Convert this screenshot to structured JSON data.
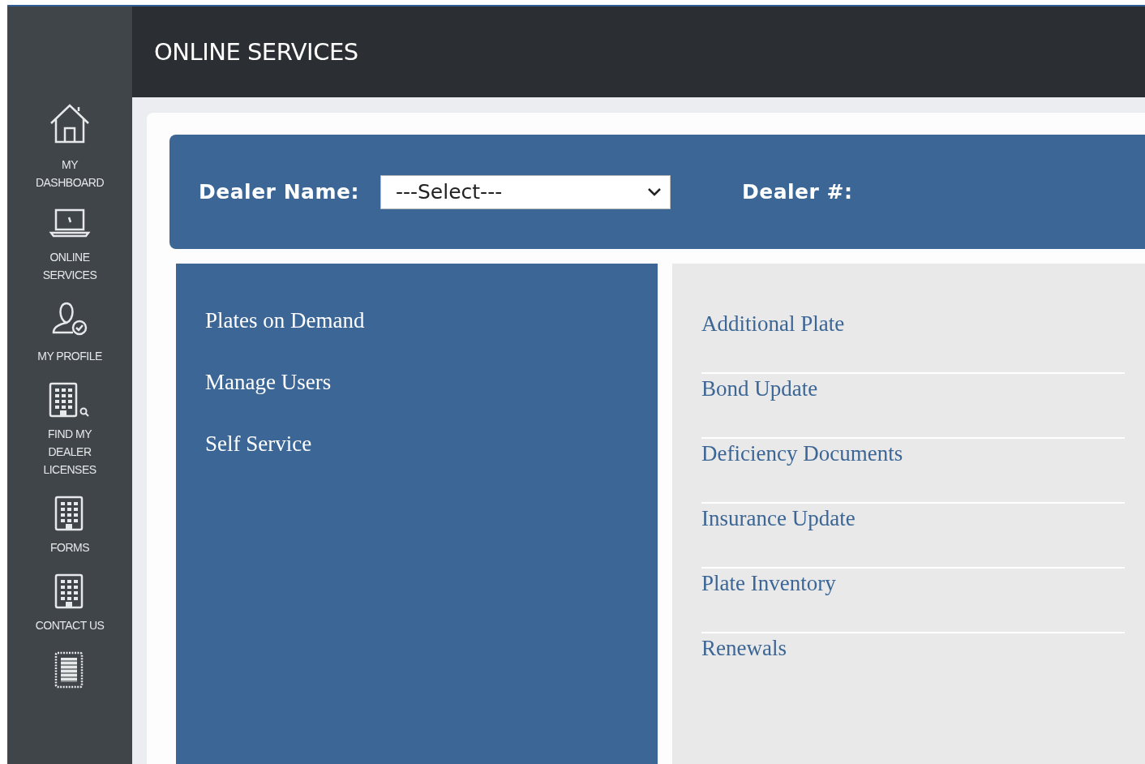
{
  "sidebar": {
    "items": [
      {
        "label": "MY DASHBOARD"
      },
      {
        "label": "ONLINE SERVICES"
      },
      {
        "label": "MY PROFILE"
      },
      {
        "label": "FIND MY DEALER LICENSES"
      },
      {
        "label": "FORMS"
      },
      {
        "label": "CONTACT US"
      }
    ]
  },
  "header": {
    "title": "ONLINE SERVICES"
  },
  "dealer_bar": {
    "name_label": "Dealer Name:",
    "name_select": {
      "value": "---Select---"
    },
    "number_label": "Dealer #:"
  },
  "menu": {
    "items": [
      "Plates on Demand",
      "Manage Users",
      "Self Service"
    ]
  },
  "links": {
    "items": [
      "Additional Plate",
      "Bond Update",
      "Deficiency Documents",
      "Insurance Update",
      "Plate Inventory",
      "Renewals"
    ]
  }
}
